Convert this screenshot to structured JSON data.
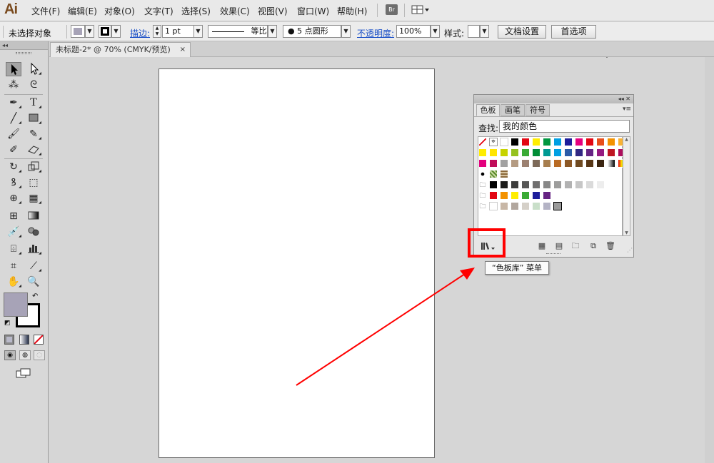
{
  "app": {
    "logo": "Ai",
    "menu": [
      "文件(F)",
      "编辑(E)",
      "对象(O)",
      "文字(T)",
      "选择(S)",
      "效果(C)",
      "视图(V)",
      "窗口(W)",
      "帮助(H)"
    ],
    "bridge_badge": "Br"
  },
  "controlbar": {
    "selection_status": "未选择对象",
    "stroke_link": "描边:",
    "stroke_weight": "1 pt",
    "stroke_profile": "等比",
    "brush": "● 5 点圆形",
    "opacity_link": "不透明度:",
    "opacity_value": "100%",
    "style_label": "样式:",
    "doc_setup_button": "文档设置",
    "preferences_button": "首选项",
    "fill_color": "#a7a3b7"
  },
  "document": {
    "tab_title": "未标题-2* @ 70% (CMYK/预览)",
    "tab_close": "×"
  },
  "toolbox": {
    "collapse_glyph": "◂◂",
    "fill_color": "#a7a3b7",
    "stroke_color": "#000000"
  },
  "swatches_panel": {
    "title_glyphs": "◂◂ ✕",
    "tabs": [
      "色板",
      "画笔",
      "符号"
    ],
    "menu_glyph": "▾≡",
    "find_label": "查找:",
    "find_value": "我的颜色",
    "rows": [
      [
        "none",
        "registration",
        "#ffffff",
        "#000000",
        "#e30613",
        "#ffed00",
        "#009640",
        "#009fe3",
        "#1d1d9b",
        "#e6007e",
        "#e30613",
        "#e84e1b",
        "#f39200",
        "#f9b233"
      ],
      [
        "#ffed00",
        "#ffe500",
        "#c7d300",
        "#95c11f",
        "#3aaa35",
        "#008d36",
        "#009a93",
        "#00a0e3",
        "#2b5ba8",
        "#312783",
        "#662483",
        "#951b81",
        "#be1622",
        "#ad0d5c"
      ],
      [
        "#e3007d",
        "#c00d5a",
        "#a2a2a2",
        "#b49b82",
        "#9c8171",
        "#7d6a59",
        "#a77e4e",
        "#b96b24",
        "#8c5825",
        "#6f4a21",
        "#573616",
        "#3b2511",
        "#gradient1",
        "#gradient2"
      ],
      [
        "pattern1",
        "pattern2",
        "pattern3"
      ],
      [
        "folder",
        "#000000",
        "#1d1d1b",
        "#3c3c3b",
        "#575756",
        "#706f6f",
        "#878787",
        "#9d9d9c",
        "#b2b2b2",
        "#c6c6c6",
        "#dadada",
        "#ededed"
      ],
      [
        "folder",
        "#e30613",
        "#f39200",
        "#ffed00",
        "#3aaa35",
        "#1d1d9b",
        "#662483"
      ],
      [
        "folder",
        "#ffffff",
        "#c8b7a6",
        "#b2a79e",
        "#d5d0c8",
        "#c9dfc9",
        "#b4b3c5",
        "#9a9a9a"
      ]
    ],
    "tooltip": "“色板库” 菜单"
  }
}
